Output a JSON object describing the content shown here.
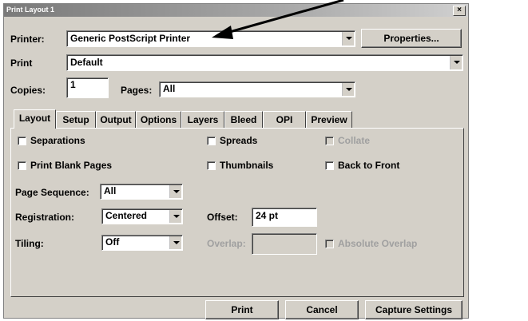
{
  "window": {
    "title": "Print Layout 1",
    "close_label": "×"
  },
  "printer": {
    "label": "Printer:",
    "value": "Generic PostScript Printer",
    "properties_button": "Properties..."
  },
  "print_style": {
    "label": "Print",
    "value": "Default"
  },
  "copies": {
    "label": "Copies:",
    "value": "1"
  },
  "pages": {
    "label": "Pages:",
    "value": "All"
  },
  "tabs": [
    {
      "label": "Layout",
      "active": true
    },
    {
      "label": "Setup",
      "active": false
    },
    {
      "label": "Output",
      "active": false
    },
    {
      "label": "Options",
      "active": false
    },
    {
      "label": "Layers",
      "active": false
    },
    {
      "label": "Bleed",
      "active": false
    },
    {
      "label": "OPI",
      "active": false
    },
    {
      "label": "Preview",
      "active": false
    }
  ],
  "layout": {
    "separations": {
      "label": "Separations",
      "checked": false
    },
    "spreads": {
      "label": "Spreads",
      "checked": false
    },
    "collate": {
      "label": "Collate",
      "checked": false,
      "disabled": true
    },
    "print_blank_pages": {
      "label": "Print Blank Pages",
      "checked": false
    },
    "thumbnails": {
      "label": "Thumbnails",
      "checked": false
    },
    "back_to_front": {
      "label": "Back to Front",
      "checked": false
    },
    "page_sequence": {
      "label": "Page Sequence:",
      "value": "All"
    },
    "registration": {
      "label": "Registration:",
      "value": "Centered"
    },
    "offset": {
      "label": "Offset:",
      "value": "24 pt"
    },
    "tiling": {
      "label": "Tiling:",
      "value": "Off"
    },
    "overlap": {
      "label": "Overlap:",
      "value": "",
      "disabled": true
    },
    "absolute_overlap": {
      "label": "Absolute Overlap",
      "checked": false,
      "disabled": true
    }
  },
  "footer": {
    "print_button": "Print",
    "cancel_button": "Cancel",
    "capture_button": "Capture Settings"
  },
  "icons": {
    "annotation": "callout-arrow-icon",
    "dropdown": "chevron-down-icon"
  },
  "colors": {
    "face": "#d4d0c8",
    "disabled_text": "#a0a0a0",
    "titlebar": "#8a8a8a"
  }
}
